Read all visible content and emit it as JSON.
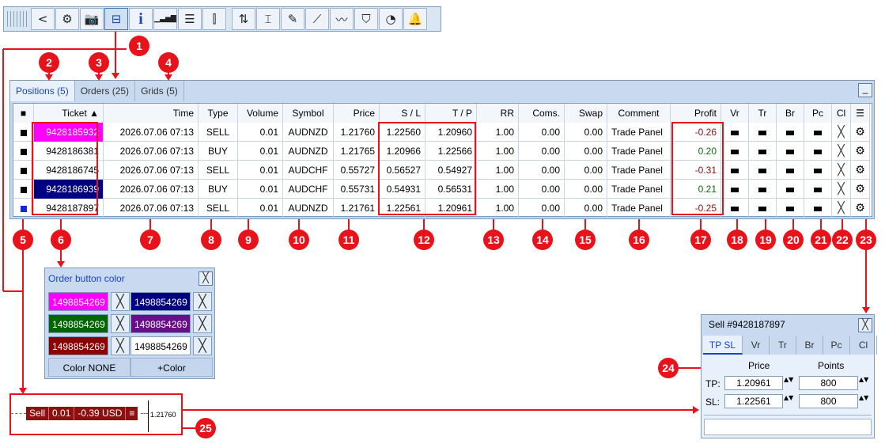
{
  "toolbar": {
    "icons": [
      "back-icon",
      "gear-icon",
      "camera-icon",
      "toolbox-icon",
      "info-icon",
      "signal-icon",
      "list-icon",
      "candles-icon",
      "sort-icon",
      "range-icon",
      "edit-icon",
      "trend-icon",
      "chart-icon",
      "shield-icon",
      "pie-icon",
      "bell-icon"
    ],
    "glyphs": [
      "<",
      "⚙",
      "📷",
      "⊟",
      "i",
      "▁▃▅▇",
      "☰",
      "⫿",
      "⇅",
      "⌶",
      "✎",
      "⟋",
      "〰",
      "⛉",
      "◔",
      "🔔"
    ]
  },
  "panel": {
    "tabs": [
      "Positions (5)",
      "Orders (25)",
      "Grids (5)"
    ],
    "minimize_glyph": "_"
  },
  "table": {
    "headers": [
      "■",
      "Ticket ▲",
      "Time",
      "Type",
      "Volume",
      "Symbol",
      "Price",
      "S / L",
      "T / P",
      "RR",
      "Coms.",
      "Swap",
      "Comment",
      "Profit",
      "Vr",
      "Tr",
      "Br",
      "Pc",
      "Cl",
      "☰"
    ],
    "rows": [
      {
        "ticket": "9428185932",
        "time": "2026.07.06 07:13",
        "type": "SELL",
        "volume": "0.01",
        "symbol": "AUDNZD",
        "price": "1.21760",
        "sl": "1.22560",
        "tp": "1.20960",
        "rr": "1.00",
        "coms": "0.00",
        "swap": "0.00",
        "comment": "Trade Panel",
        "profit": "-0.26"
      },
      {
        "ticket": "9428186381",
        "time": "2026.07.06 07:13",
        "type": "BUY",
        "volume": "0.01",
        "symbol": "AUDNZD",
        "price": "1.21765",
        "sl": "1.20966",
        "tp": "1.22566",
        "rr": "1.00",
        "coms": "0.00",
        "swap": "0.00",
        "comment": "Trade Panel",
        "profit": "0.20"
      },
      {
        "ticket": "9428186745",
        "time": "2026.07.06 07:13",
        "type": "SELL",
        "volume": "0.01",
        "symbol": "AUDCHF",
        "price": "0.55727",
        "sl": "0.56527",
        "tp": "0.54927",
        "rr": "1.00",
        "coms": "0.00",
        "swap": "0.00",
        "comment": "Trade Panel",
        "profit": "-0.31"
      },
      {
        "ticket": "9428186939",
        "time": "2026.07.06 07:13",
        "type": "BUY",
        "volume": "0.01",
        "symbol": "AUDCHF",
        "price": "0.55731",
        "sl": "0.54931",
        "tp": "0.56531",
        "rr": "1.00",
        "coms": "0.00",
        "swap": "0.00",
        "comment": "Trade Panel",
        "profit": "0.21"
      },
      {
        "ticket": "9428187897",
        "time": "2026.07.06 07:13",
        "type": "SELL",
        "volume": "0.01",
        "symbol": "AUDNZD",
        "price": "1.21761",
        "sl": "1.22561",
        "tp": "1.20961",
        "rr": "1.00",
        "coms": "0.00",
        "swap": "0.00",
        "comment": "Trade Panel",
        "profit": "-0.25"
      }
    ],
    "ticket_colors": [
      "#ff00ff",
      "",
      "",
      "#000080",
      ""
    ],
    "row_icons": {
      "x": "╳",
      "gear": "⚙"
    }
  },
  "markers": [
    "1",
    "2",
    "3",
    "4",
    "5",
    "6",
    "7",
    "8",
    "9",
    "10",
    "11",
    "12",
    "13",
    "14",
    "15",
    "16",
    "17",
    "18",
    "19",
    "20",
    "21",
    "22",
    "23",
    "24",
    "25"
  ],
  "color_dialog": {
    "title": "Order button color",
    "close": "╳",
    "swatches": [
      {
        "label": "1498854269",
        "bg": "#ff00ff",
        "fg": "#ffffff"
      },
      {
        "label": "1498854269",
        "bg": "#000080",
        "fg": "#ffffff"
      },
      {
        "label": "1498854269",
        "bg": "#006400",
        "fg": "#ffffff"
      },
      {
        "label": "1498854269",
        "bg": "#6a0d8a",
        "fg": "#ffffff"
      },
      {
        "label": "1498854269",
        "bg": "#8b0000",
        "fg": "#ffffff"
      },
      {
        "label": "1498854269",
        "bg": "#ffffff",
        "fg": "#000000"
      }
    ],
    "swatch_x": "╳",
    "btn_none": "Color NONE",
    "btn_add": "+Color"
  },
  "chart_label": {
    "side": "Sell",
    "volume": "0.01",
    "pnl": "-0.39 USD",
    "menu": "≡",
    "price_tick": "1.21760"
  },
  "order_dialog": {
    "title": "Sell  #9428187897",
    "close": "╳",
    "tabs": [
      "TP SL",
      "Vr",
      "Tr",
      "Br",
      "Pc",
      "Cl"
    ],
    "col_price": "Price",
    "col_points": "Points",
    "tp_label": "TP:",
    "sl_label": "SL:",
    "tp_price": "1.20961",
    "tp_points": "800",
    "sl_price": "1.22561",
    "sl_points": "800",
    "spin": "▲▼"
  },
  "colors": {
    "accent": "#e8121a",
    "panel": "#c9daf0",
    "profit_pos": "#0c6b12",
    "profit_neg": "#8b1010"
  }
}
